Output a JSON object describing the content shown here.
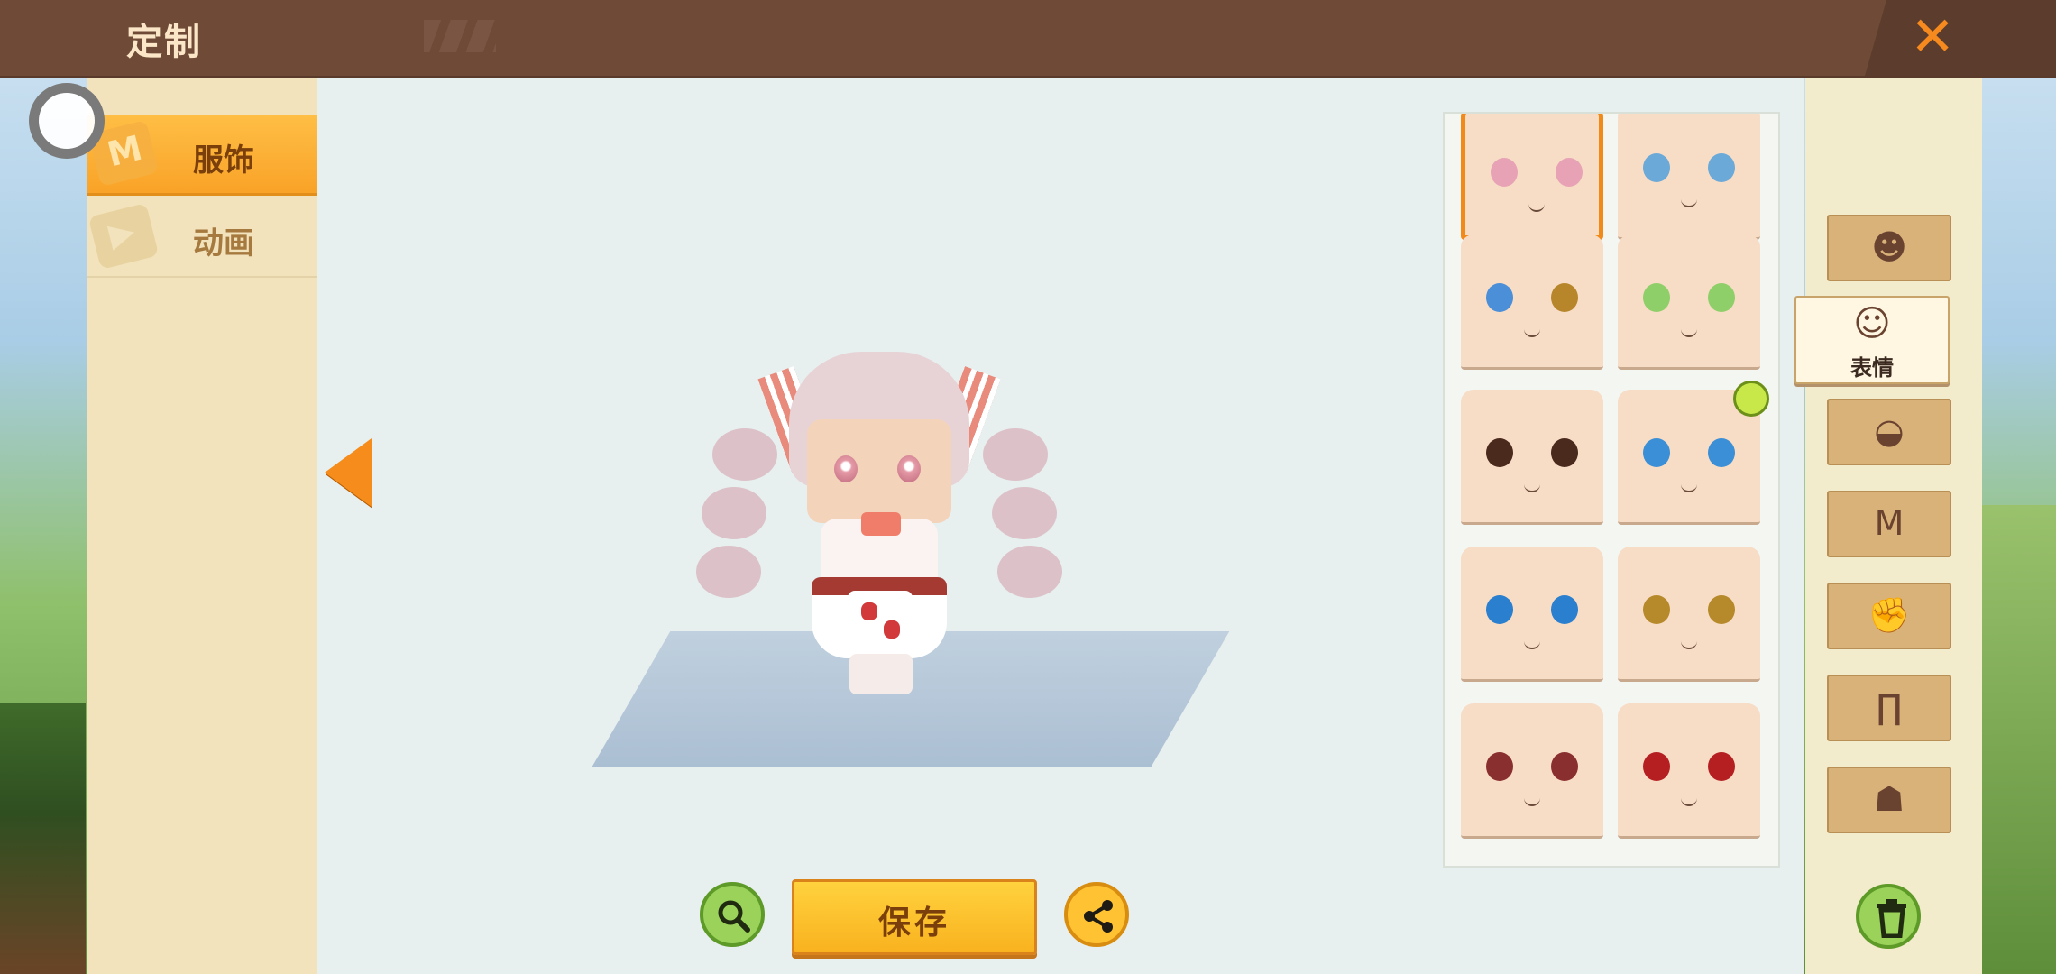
{
  "header": {
    "title": "定制",
    "close_icon": "close-x-icon"
  },
  "tabs": [
    {
      "label": "服饰",
      "icon": "tshirt-m-icon",
      "selected": true
    },
    {
      "label": "动画",
      "icon": "play-triangle-icon",
      "selected": false
    }
  ],
  "icons": {
    "tshirt_glyph": "M",
    "anim_glyph": "▶"
  },
  "actions": {
    "save_label": "保存",
    "zoom_icon": "magnifier-icon",
    "share_icon": "share-icon",
    "delete_icon": "trash-icon"
  },
  "categories": [
    {
      "id": "hair",
      "icon": "hair-head-icon",
      "glyph": "☻"
    },
    {
      "id": "expression",
      "icon": "face-icon",
      "glyph": "☺",
      "label": "表情",
      "active": true
    },
    {
      "id": "mask",
      "icon": "mask-icon",
      "glyph": "◒"
    },
    {
      "id": "top",
      "icon": "shirt-icon",
      "glyph": "M"
    },
    {
      "id": "gloves",
      "icon": "glove-icon",
      "glyph": "✊"
    },
    {
      "id": "pants",
      "icon": "pants-icon",
      "glyph": "∏"
    },
    {
      "id": "shoes",
      "icon": "shoes-icon",
      "glyph": "☗"
    }
  ],
  "faces": {
    "count_visible": 10,
    "selected_index": 0,
    "timed_index": 5
  },
  "colors": {
    "accent": "#f78a1e",
    "header_bg": "#6e4a37",
    "panel_bg": "#f2e3bd"
  }
}
